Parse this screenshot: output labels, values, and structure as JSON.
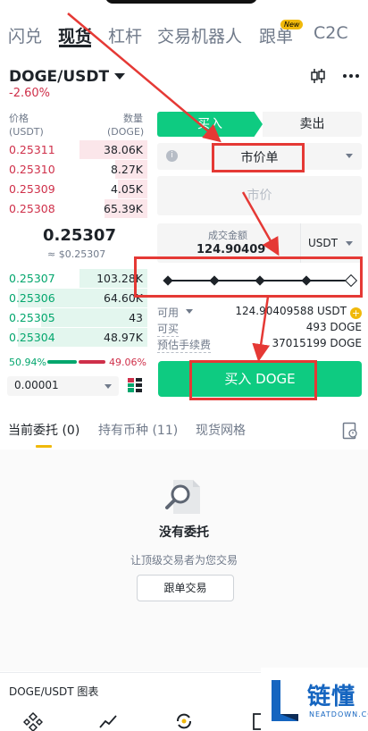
{
  "nav": {
    "tabs": [
      "闪兑",
      "现货",
      "杠杆",
      "交易机器人",
      "跟单",
      "C2C"
    ],
    "active": "现货",
    "new_badge": "New"
  },
  "pair": {
    "symbol": "DOGE/USDT",
    "change": "-2.60%"
  },
  "orderbook": {
    "price_label": "价格",
    "price_unit": "(USDT)",
    "qty_label": "数量",
    "qty_unit": "(DOGE)",
    "asks": [
      {
        "price": "0.25311",
        "qty": "38.06K",
        "depth": 0.46
      },
      {
        "price": "0.25310",
        "qty": "8.27K",
        "depth": 0.22
      },
      {
        "price": "0.25309",
        "qty": "4.05K",
        "depth": 0.2
      },
      {
        "price": "0.25308",
        "qty": "65.39K",
        "depth": 0.29
      }
    ],
    "last_price": "0.25307",
    "last_price_usd": "≈ $0.25307",
    "bids": [
      {
        "price": "0.25307",
        "qty": "103.28K",
        "depth": 0.46
      },
      {
        "price": "0.25306",
        "qty": "64.60K",
        "depth": 0.88
      },
      {
        "price": "0.25305",
        "qty": "43",
        "depth": 0.72
      },
      {
        "price": "0.25304",
        "qty": "48.97K",
        "depth": 0.88
      }
    ],
    "buy_ratio": "50.94%",
    "sell_ratio": "49.06%",
    "precision": "0.00001"
  },
  "form": {
    "buy_tab": "买入",
    "sell_tab": "卖出",
    "order_type": "市价单",
    "price_placeholder": "市价",
    "amount_label": "成交金额",
    "amount_value": "124.90409",
    "amount_unit": "USDT",
    "slider_percent": 100,
    "available_label": "可用",
    "available_value": "124.90409588 USDT",
    "buyable_label": "可买",
    "buyable_value": "493 DOGE",
    "fee_label": "预估手续费",
    "fee_value": "37015199 DOGE",
    "buy_button": "买入 DOGE"
  },
  "orders_tabs": {
    "tabs": [
      "当前委托 (0)",
      "持有币种 (11)",
      "现货网格"
    ]
  },
  "empty": {
    "title": "没有委托",
    "subtitle": "让顶级交易者为您交易",
    "button": "跟单交易"
  },
  "chart_bar": {
    "label": "DOGE/USDT 图表"
  },
  "watermark": {
    "brand": "链懂",
    "domain": "NEATDOWN.COM"
  },
  "colors": {
    "buy_green": "#0ecb81",
    "sell_red": "#cf304a",
    "accent": "#f0b90b",
    "annotation_red": "#e53935"
  }
}
